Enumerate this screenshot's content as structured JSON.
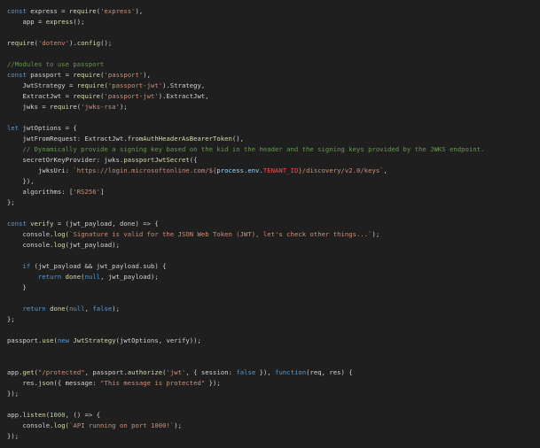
{
  "editor": {
    "language": "javascript",
    "background": "#1f1f1f"
  },
  "colors": {
    "keyword": "#569cd6",
    "string": "#ce9178",
    "function": "#dcdcaa",
    "comment": "#6a9955",
    "variable": "#9cdcfe",
    "number": "#b5cea8",
    "highlight": "#ff4b4b",
    "text": "#d4d4d4"
  },
  "code": {
    "l1": {
      "kw": "const",
      "a": " express = ",
      "fn": "require",
      "b": "(",
      "s": "'express'",
      "c": "),"
    },
    "l2": {
      "a": "    app = ",
      "fn": "express",
      "b": "();"
    },
    "l3": {
      "fn": "require",
      "a": "(",
      "s": "'dotenv'",
      "b": ").",
      "fn2": "config",
      "c": "();"
    },
    "l4": {
      "comment": "//Modules to use passport"
    },
    "l5": {
      "kw": "const",
      "a": " passport = ",
      "fn": "require",
      "b": "(",
      "s": "'passport'",
      "c": "),"
    },
    "l6": {
      "a": "    JwtStrategy = ",
      "fn": "require",
      "b": "(",
      "s": "'passport-jwt'",
      "c": ").Strategy,"
    },
    "l7": {
      "a": "    ExtractJwt = ",
      "fn": "require",
      "b": "(",
      "s": "'passport-jwt'",
      "c": ").ExtractJwt,"
    },
    "l8": {
      "a": "    jwks = ",
      "fn": "require",
      "b": "(",
      "s": "'jwks-rsa'",
      "c": ");"
    },
    "l9": {
      "kw": "let",
      "a": " jwtOptions = {"
    },
    "l10": {
      "a": "    jwtFromRequest: ExtractJwt.",
      "fn": "fromAuthHeaderAsBearerToken",
      "b": "(),"
    },
    "l11": {
      "comment": "    // Dynamically provide a signing key based on the kid in the header and the signing keys provided by the JWKS endpoint."
    },
    "l12": {
      "a": "    secretOrKeyProvider: jwks.",
      "fn": "passportJwtSecret",
      "b": "({"
    },
    "l13": {
      "a": "        jwksUri: ",
      "s1": "`https://login.microsoftonline.com/${",
      "v": "process.env.",
      "t": "TENANT_ID",
      "s2": "}/discovery/v2.0/keys`",
      "b": ","
    },
    "l14": {
      "a": "    }),"
    },
    "l15": {
      "a": "    algorithms: [",
      "s": "'RS256'",
      "b": "]"
    },
    "l16": {
      "a": "};"
    },
    "l17": {
      "kw": "const",
      "fn": " verify",
      "a": " = (jwt_payload, done) => {"
    },
    "l18": {
      "a": "    console.",
      "fn": "log",
      "b": "(",
      "s": "`Signature is valid for the JSON Web Token (JWT), let's check other things...`",
      "c": ");"
    },
    "l19": {
      "a": "    console.",
      "fn": "log",
      "b": "(jwt_payload);"
    },
    "l20": {
      "kw": "    if",
      "a": " (jwt_payload && jwt_payload.sub) {"
    },
    "l21": {
      "kw": "        return",
      "fn": " done",
      "a": "(",
      "kw2": "null",
      "b": ", jwt_payload);"
    },
    "l22": {
      "a": "    }"
    },
    "l23": {
      "kw": "    return",
      "fn": " done",
      "a": "(",
      "kw2": "null",
      "b": ", ",
      "kw3": "false",
      "c": ");"
    },
    "l24": {
      "a": "};"
    },
    "l25": {
      "a": "passport.",
      "fn": "use",
      "b": "(",
      "kw": "new",
      "fn2": " JwtStrategy",
      "c": "(jwtOptions, verify));"
    },
    "l26": {
      "a": "app.",
      "fn": "get",
      "b": "(",
      "s": "\"/protected\"",
      "c": ", passport.",
      "fn2": "authorize",
      "d": "(",
      "s2": "'jwt'",
      "e": ", { session: ",
      "kw": "false",
      "f": " }), ",
      "kw2": "function",
      "g": "(req, res) {"
    },
    "l27": {
      "a": "    res.",
      "fn": "json",
      "b": "({ message: ",
      "s": "\"This message is protected\"",
      "c": " });"
    },
    "l28": {
      "a": "});"
    },
    "l29": {
      "a": "app.",
      "fn": "listen",
      "b": "(",
      "n": "1000",
      "c": ", () => {"
    },
    "l30": {
      "a": "    console.",
      "fn": "log",
      "b": "(",
      "s": "`API running on port 1000!`",
      "c": ");"
    },
    "l31": {
      "a": "});"
    }
  }
}
